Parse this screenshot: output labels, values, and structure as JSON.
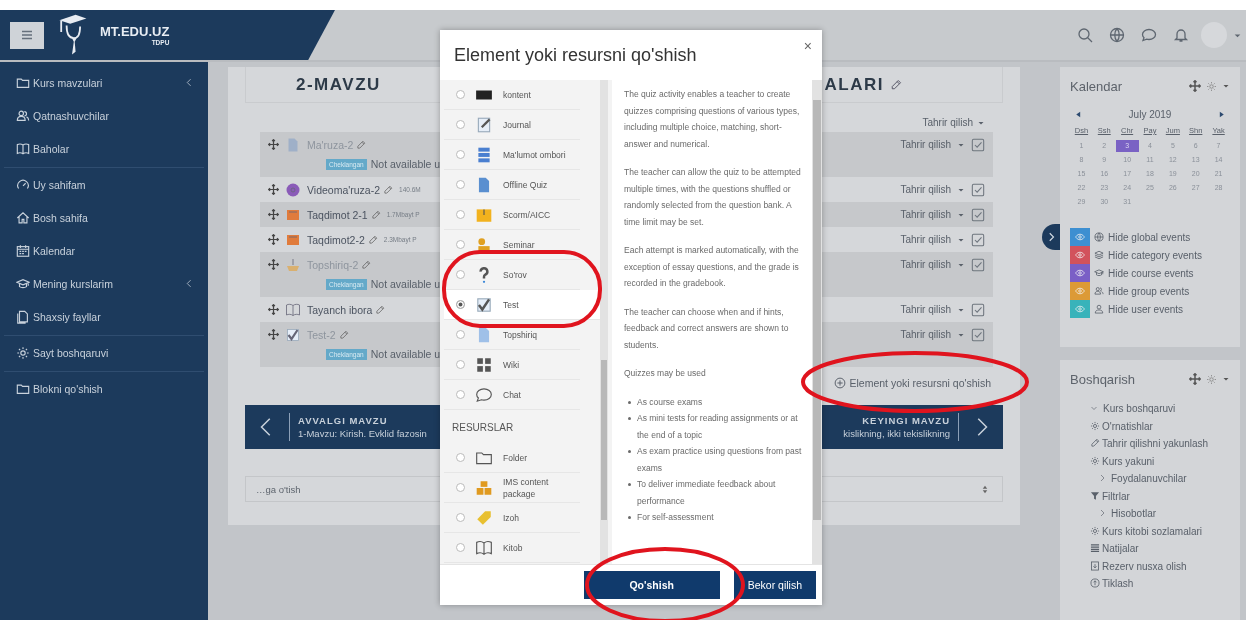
{
  "header": {
    "logo_title": "MT.EDU.UZ",
    "logo_subtitle": "TDPU"
  },
  "sidebar": {
    "groups": [
      {
        "items": [
          {
            "label": "Kurs mavzulari",
            "collapsible": true
          },
          {
            "label": "Qatnashuvchilar",
            "collapsible": false
          },
          {
            "label": "Baholar",
            "collapsible": false
          }
        ]
      },
      {
        "items": [
          {
            "label": "Uy sahifam",
            "collapsible": false
          },
          {
            "label": "Bosh sahifa",
            "collapsible": false
          },
          {
            "label": "Kalendar",
            "collapsible": false
          },
          {
            "label": "Mening kurslarim",
            "collapsible": true
          },
          {
            "label": "Shaxsiy fayllar",
            "collapsible": false
          }
        ]
      },
      {
        "items": [
          {
            "label": "Sayt boshqaruvi",
            "collapsible": false
          }
        ]
      },
      {
        "items": [
          {
            "label": "Blokni qo'shish",
            "collapsible": false
          }
        ]
      }
    ]
  },
  "course": {
    "title_start": "2-MAVZU",
    "title_end": "ALARI",
    "section_edit": "Tahrir qilish",
    "rows": [
      {
        "kind": "page",
        "name": "Ma'ruza-2",
        "dimmed": true,
        "edit": "Tahrir qilish",
        "completed": true,
        "restriction": {
          "badge": "Cheklangan",
          "text": "Not available u"
        }
      },
      {
        "kind": "video",
        "name": "Videoma'ruza-2",
        "size": "140.6M",
        "dimmed": false,
        "edit": "Tahrir qilish",
        "completed": true
      },
      {
        "kind": "slides",
        "name": "Taqdimot 2-1",
        "size": "1.7Mbayt P",
        "dimmed": false,
        "edit": "Tahrir qilish",
        "completed": true
      },
      {
        "kind": "slides",
        "name": "Taqdimot2-2",
        "size": "2.3Mbayt P",
        "dimmed": false,
        "edit": "Tahrir qilish",
        "completed": true
      },
      {
        "kind": "assignment",
        "name": "Topshiriq-2",
        "dimmed": true,
        "edit": "Tahrir qilish",
        "completed": true,
        "restriction": {
          "badge": "Cheklangan",
          "text": "Not available u"
        }
      },
      {
        "kind": "glossary",
        "name": "Tayanch ibora",
        "dimmed": false,
        "edit": "Tahrir qilish",
        "completed": true
      },
      {
        "kind": "quiz",
        "name": "Test-2",
        "dimmed": true,
        "edit": "Tahrir qilish",
        "completed": true,
        "restriction": {
          "badge": "Cheklangan",
          "text": "Not available u"
        }
      }
    ],
    "add_link": "Element yoki resursni qo'shish",
    "prev": {
      "label": "AVVALGI MAVZU",
      "title": "1-Mavzu: Kirish. Evklid fazosin"
    },
    "next": {
      "label": "KEYINGI MAVZU",
      "title": "kislikning, ikki tekislikning"
    },
    "jump_select": "…ga o'tish"
  },
  "modal": {
    "title": "Element yoki resursni qo'shish",
    "close": "×",
    "items": [
      {
        "kind": "option",
        "label": "kontent",
        "selected": false
      },
      {
        "kind": "option",
        "label": "Journal",
        "selected": false
      },
      {
        "kind": "option",
        "label": "Ma'lumot ombori",
        "selected": false
      },
      {
        "kind": "option",
        "label": "Offline Quiz",
        "selected": false
      },
      {
        "kind": "option",
        "label": "Scorm/AICC",
        "selected": false
      },
      {
        "kind": "option",
        "label": "Seminar",
        "selected": false
      },
      {
        "kind": "option",
        "label": "So'rov",
        "selected": false
      },
      {
        "kind": "option",
        "label": "Test",
        "selected": true
      },
      {
        "kind": "option",
        "label": "Topshiriq",
        "selected": false
      },
      {
        "kind": "option",
        "label": "Wiki",
        "selected": false
      },
      {
        "kind": "option",
        "label": "Chat",
        "selected": false
      },
      {
        "kind": "heading",
        "label": "RESURSLAR"
      },
      {
        "kind": "option",
        "label": "Folder",
        "selected": false
      },
      {
        "kind": "option",
        "label": "IMS content package",
        "selected": false
      },
      {
        "kind": "option",
        "label": "Izoh",
        "selected": false
      },
      {
        "kind": "option",
        "label": "Kitob",
        "selected": false
      }
    ],
    "paragraphs": [
      "The quiz activity enables a teacher to create quizzes comprising questions of various types, including multiple choice, matching, short-answer and numerical.",
      "The teacher can allow the quiz to be attempted multiple times, with the questions shuffled or randomly selected from the question bank. A time limit may be set.",
      "Each attempt is marked automatically, with the exception of essay questions, and the grade is recorded in the gradebook.",
      "The teacher can choose when and if hints, feedback and correct answers are shown to students.",
      "Quizzes may be used"
    ],
    "bullets": [
      "As course exams",
      "As mini tests for reading assignments or at the end of a topic",
      "As exam practice using questions from past exams",
      "To deliver immediate feedback about performance",
      "For self-assessment"
    ],
    "buttons": [
      {
        "label": "Qo'shish",
        "primary": true
      },
      {
        "label": "Bekor qilish",
        "primary": false
      }
    ]
  },
  "calendar": {
    "title": "Kalendar",
    "month": "July 2019",
    "weekdays": [
      "Dsh",
      "Ssh",
      "Chr",
      "Pay",
      "Jum",
      "Shn",
      "Yak"
    ],
    "days": [
      {
        "day": "1",
        "today": false
      },
      {
        "day": "2",
        "today": false
      },
      {
        "day": "3",
        "today": true
      },
      {
        "day": "4",
        "today": false
      },
      {
        "day": "5",
        "today": false
      },
      {
        "day": "6",
        "today": false
      },
      {
        "day": "7",
        "today": false
      },
      {
        "day": "8",
        "today": false
      },
      {
        "day": "9",
        "today": false
      },
      {
        "day": "10",
        "today": false
      },
      {
        "day": "11",
        "today": false
      },
      {
        "day": "12",
        "today": false
      },
      {
        "day": "13",
        "today": false
      },
      {
        "day": "14",
        "today": false
      },
      {
        "day": "15",
        "today": false
      },
      {
        "day": "16",
        "today": false
      },
      {
        "day": "17",
        "today": false
      },
      {
        "day": "18",
        "today": false
      },
      {
        "day": "19",
        "today": false
      },
      {
        "day": "20",
        "today": false
      },
      {
        "day": "21",
        "today": false
      },
      {
        "day": "22",
        "today": false
      },
      {
        "day": "23",
        "today": false
      },
      {
        "day": "24",
        "today": false
      },
      {
        "day": "25",
        "today": false
      },
      {
        "day": "26",
        "today": false
      },
      {
        "day": "27",
        "today": false
      },
      {
        "day": "28",
        "today": false
      },
      {
        "day": "29",
        "today": false
      },
      {
        "day": "30",
        "today": false
      },
      {
        "day": "31",
        "today": false
      }
    ],
    "event_toggles": [
      {
        "label": "Hide global events",
        "color": "#3d8fd1"
      },
      {
        "label": "Hide category events",
        "color": "#d2525c"
      },
      {
        "label": "Hide course events",
        "color": "#7a5fc6"
      },
      {
        "label": "Hide group events",
        "color": "#dc9a36"
      },
      {
        "label": "Hide user events",
        "color": "#38b3ba"
      }
    ]
  },
  "admin": {
    "title": "Boshqarish",
    "tree": [
      {
        "label": "Kurs boshqaruvi",
        "expanded": true,
        "children": [
          {
            "label": "O'rnatishlar"
          },
          {
            "label": "Tahrir qilishni yakunlash"
          },
          {
            "label": "Kurs yakuni"
          },
          {
            "label": "Foydalanuvchilar",
            "expanded": false
          },
          {
            "label": "Filtrlar"
          },
          {
            "label": "Hisobotlar",
            "expanded": false
          },
          {
            "label": "Kurs kitobi sozlamalari"
          },
          {
            "label": "Natijalar"
          },
          {
            "label": "Rezerv nusxa olish"
          },
          {
            "label": "Tiklash"
          }
        ]
      }
    ]
  },
  "annotations": [
    {
      "kind": "ellipse"
    },
    {
      "kind": "ellipse"
    },
    {
      "kind": "ellipse"
    }
  ]
}
